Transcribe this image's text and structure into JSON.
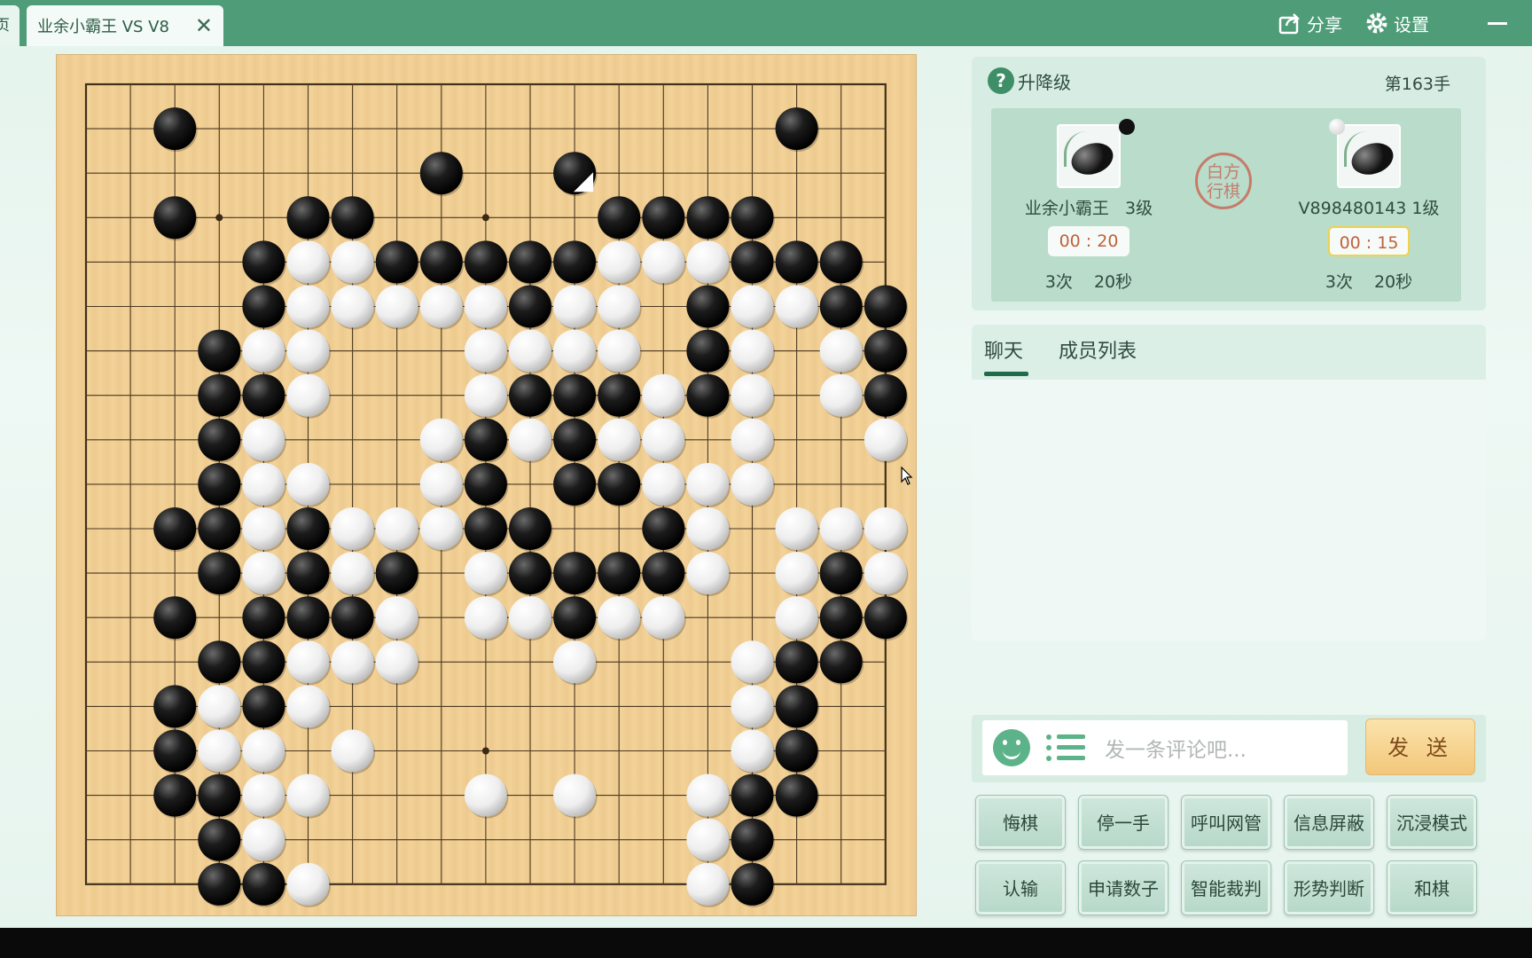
{
  "tabs": {
    "left_partial": "页",
    "active_title": "业余小霸王 VS V8",
    "close": "✕"
  },
  "toolbar": {
    "share": "分享",
    "settings": "设置"
  },
  "game_panel": {
    "level_label": "升降级",
    "help_glyph": "?",
    "move_number": "第163手",
    "turn_seal": "白方\n行棋",
    "black_player": {
      "name": "业余小霸王",
      "rank": "3级",
      "timer": "00 : 20",
      "byoyomi": "3次 20秒",
      "color": "black"
    },
    "white_player": {
      "name": "V898480143",
      "rank": "1级",
      "timer": "00 : 15",
      "byoyomi": "3次 20秒",
      "color": "white",
      "active": true
    }
  },
  "chat": {
    "tabs": [
      {
        "label": "聊天",
        "active": true
      },
      {
        "label": "成员列表",
        "active": false
      }
    ],
    "input_placeholder": "发一条评论吧...",
    "send_label": "发 送"
  },
  "actions": {
    "row1": [
      "悔棋",
      "停一手",
      "呼叫网管",
      "信息屏蔽",
      "沉浸模式"
    ],
    "row2": [
      "认输",
      "申请数子",
      "智能裁判",
      "形势判断",
      "和棋"
    ]
  },
  "board": {
    "size": 19,
    "last_move": [
      11,
      2
    ],
    "black": [
      [
        2,
        1
      ],
      [
        16,
        1
      ],
      [
        8,
        2
      ],
      [
        11,
        2
      ],
      [
        2,
        3
      ],
      [
        5,
        3
      ],
      [
        6,
        3
      ],
      [
        12,
        3
      ],
      [
        13,
        3
      ],
      [
        14,
        3
      ],
      [
        15,
        3
      ],
      [
        4,
        4
      ],
      [
        7,
        4
      ],
      [
        8,
        4
      ],
      [
        9,
        4
      ],
      [
        10,
        4
      ],
      [
        11,
        4
      ],
      [
        15,
        4
      ],
      [
        16,
        4
      ],
      [
        17,
        4
      ],
      [
        4,
        5
      ],
      [
        10,
        5
      ],
      [
        14,
        5
      ],
      [
        17,
        5
      ],
      [
        18,
        5
      ],
      [
        3,
        6
      ],
      [
        14,
        6
      ],
      [
        18,
        6
      ],
      [
        3,
        7
      ],
      [
        4,
        7
      ],
      [
        10,
        7
      ],
      [
        11,
        7
      ],
      [
        12,
        7
      ],
      [
        14,
        7
      ],
      [
        18,
        7
      ],
      [
        3,
        8
      ],
      [
        9,
        8
      ],
      [
        11,
        8
      ],
      [
        3,
        9
      ],
      [
        9,
        9
      ],
      [
        11,
        9
      ],
      [
        12,
        9
      ],
      [
        2,
        10
      ],
      [
        3,
        10
      ],
      [
        5,
        10
      ],
      [
        9,
        10
      ],
      [
        10,
        10
      ],
      [
        13,
        10
      ],
      [
        3,
        11
      ],
      [
        5,
        11
      ],
      [
        7,
        11
      ],
      [
        10,
        11
      ],
      [
        11,
        11
      ],
      [
        12,
        11
      ],
      [
        13,
        11
      ],
      [
        17,
        11
      ],
      [
        2,
        12
      ],
      [
        4,
        12
      ],
      [
        5,
        12
      ],
      [
        6,
        12
      ],
      [
        11,
        12
      ],
      [
        17,
        12
      ],
      [
        18,
        12
      ],
      [
        3,
        13
      ],
      [
        4,
        13
      ],
      [
        16,
        13
      ],
      [
        17,
        13
      ],
      [
        2,
        14
      ],
      [
        4,
        14
      ],
      [
        16,
        14
      ],
      [
        2,
        15
      ],
      [
        16,
        15
      ],
      [
        2,
        16
      ],
      [
        3,
        16
      ],
      [
        15,
        16
      ],
      [
        16,
        16
      ],
      [
        3,
        17
      ],
      [
        15,
        17
      ],
      [
        3,
        18
      ],
      [
        4,
        18
      ],
      [
        15,
        18
      ]
    ],
    "white": [
      [
        5,
        4
      ],
      [
        6,
        4
      ],
      [
        12,
        4
      ],
      [
        13,
        4
      ],
      [
        14,
        4
      ],
      [
        5,
        5
      ],
      [
        6,
        5
      ],
      [
        7,
        5
      ],
      [
        8,
        5
      ],
      [
        9,
        5
      ],
      [
        11,
        5
      ],
      [
        12,
        5
      ],
      [
        15,
        5
      ],
      [
        16,
        5
      ],
      [
        4,
        6
      ],
      [
        5,
        6
      ],
      [
        9,
        6
      ],
      [
        10,
        6
      ],
      [
        11,
        6
      ],
      [
        12,
        6
      ],
      [
        15,
        6
      ],
      [
        17,
        6
      ],
      [
        5,
        7
      ],
      [
        9,
        7
      ],
      [
        13,
        7
      ],
      [
        15,
        7
      ],
      [
        17,
        7
      ],
      [
        4,
        8
      ],
      [
        8,
        8
      ],
      [
        10,
        8
      ],
      [
        12,
        8
      ],
      [
        13,
        8
      ],
      [
        15,
        8
      ],
      [
        18,
        8
      ],
      [
        4,
        9
      ],
      [
        5,
        9
      ],
      [
        8,
        9
      ],
      [
        13,
        9
      ],
      [
        14,
        9
      ],
      [
        15,
        9
      ],
      [
        4,
        10
      ],
      [
        6,
        10
      ],
      [
        7,
        10
      ],
      [
        8,
        10
      ],
      [
        14,
        10
      ],
      [
        16,
        10
      ],
      [
        17,
        10
      ],
      [
        18,
        10
      ],
      [
        4,
        11
      ],
      [
        6,
        11
      ],
      [
        9,
        11
      ],
      [
        14,
        11
      ],
      [
        16,
        11
      ],
      [
        18,
        11
      ],
      [
        7,
        12
      ],
      [
        9,
        12
      ],
      [
        10,
        12
      ],
      [
        12,
        12
      ],
      [
        13,
        12
      ],
      [
        16,
        12
      ],
      [
        5,
        13
      ],
      [
        6,
        13
      ],
      [
        7,
        13
      ],
      [
        11,
        13
      ],
      [
        15,
        13
      ],
      [
        3,
        14
      ],
      [
        5,
        14
      ],
      [
        15,
        14
      ],
      [
        3,
        15
      ],
      [
        4,
        15
      ],
      [
        6,
        15
      ],
      [
        15,
        15
      ],
      [
        4,
        16
      ],
      [
        5,
        16
      ],
      [
        9,
        16
      ],
      [
        11,
        16
      ],
      [
        14,
        16
      ],
      [
        4,
        17
      ],
      [
        14,
        17
      ],
      [
        5,
        18
      ],
      [
        14,
        18
      ]
    ]
  }
}
